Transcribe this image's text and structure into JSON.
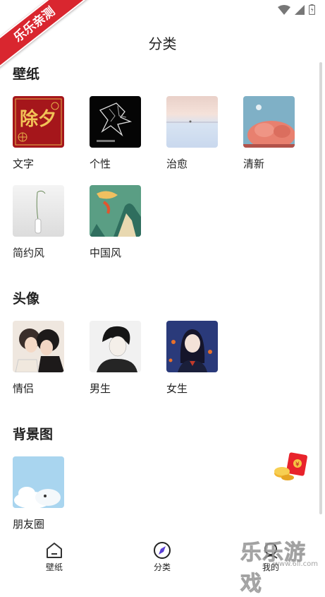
{
  "status_bar": {
    "icons": [
      "wifi-icon",
      "signal-icon",
      "battery-icon"
    ]
  },
  "corner_badge": {
    "text": "乐乐亲测"
  },
  "header": {
    "title": "分类"
  },
  "sections": [
    {
      "title": "壁纸",
      "items": [
        {
          "label": "文字",
          "thumb_text": "除夕"
        },
        {
          "label": "个性",
          "thumb_text": ""
        },
        {
          "label": "治愈"
        },
        {
          "label": "清新"
        },
        {
          "label": "简约风"
        },
        {
          "label": "中国风"
        }
      ]
    },
    {
      "title": "头像",
      "items": [
        {
          "label": "情侣"
        },
        {
          "label": "男生"
        },
        {
          "label": "女生"
        }
      ]
    },
    {
      "title": "背景图",
      "items": [
        {
          "label": "朋友圈"
        }
      ]
    }
  ],
  "bottom_nav": {
    "items": [
      {
        "label": "壁纸",
        "icon": "home-icon"
      },
      {
        "label": "分类",
        "icon": "compass-icon",
        "active": true
      },
      {
        "label": "我的",
        "icon": "profile-icon"
      }
    ]
  },
  "watermark": {
    "text": "乐乐游戏",
    "url": "www.6ll.com"
  },
  "colors": {
    "accent": "#5b3fd6",
    "badge": "#d9262f",
    "envelope": "#e8232b"
  }
}
